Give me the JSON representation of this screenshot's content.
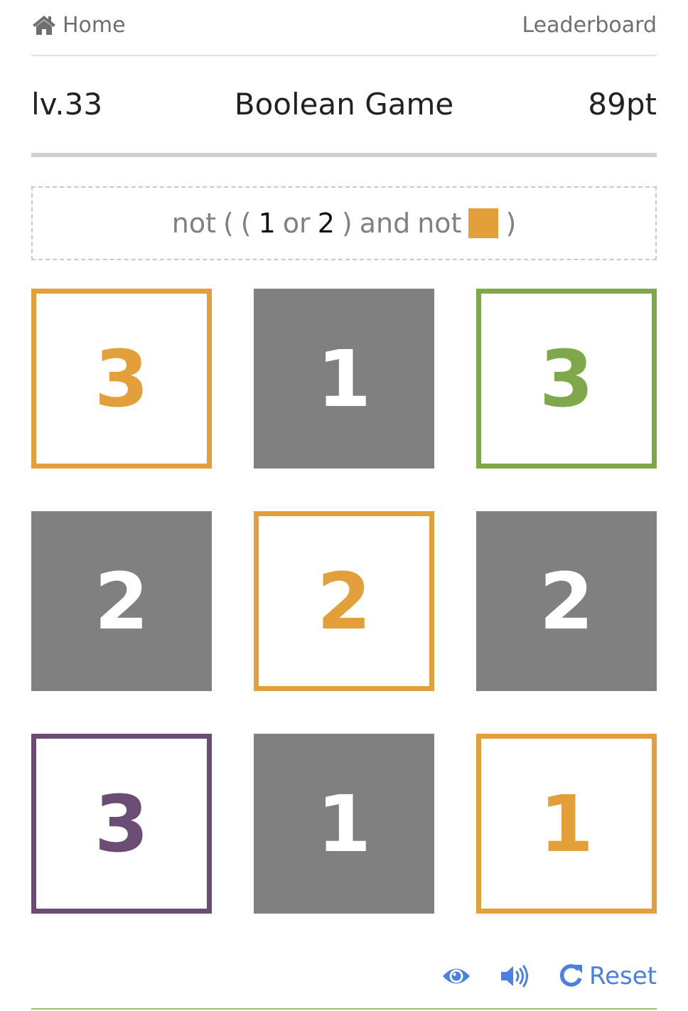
{
  "nav": {
    "home_label": "Home",
    "leaderboard_label": "Leaderboard"
  },
  "header": {
    "level": "lv.33",
    "title": "Boolean Game",
    "points": "89pt"
  },
  "expression": {
    "tokens": [
      {
        "text": "not",
        "kind": "op"
      },
      {
        "text": "(",
        "kind": "op"
      },
      {
        "text": "(",
        "kind": "op"
      },
      {
        "text": "1",
        "kind": "num"
      },
      {
        "text": "or",
        "kind": "op"
      },
      {
        "text": "2",
        "kind": "num"
      },
      {
        "text": ")",
        "kind": "op"
      },
      {
        "text": "and",
        "kind": "op"
      },
      {
        "text": "not",
        "kind": "op"
      },
      {
        "text": "",
        "kind": "swatch",
        "color": "#e3a03a"
      },
      {
        "text": ")",
        "kind": "op"
      }
    ]
  },
  "colors": {
    "orange": "#e3a03a",
    "green": "#7ea84a",
    "purple": "#6b4c74",
    "gray": "#808080",
    "accent": "#4a80e0"
  },
  "tiles": [
    {
      "value": "3",
      "style": "outline",
      "color": "#e3a03a"
    },
    {
      "value": "1",
      "style": "filled",
      "color": "#808080"
    },
    {
      "value": "3",
      "style": "outline",
      "color": "#7ea84a"
    },
    {
      "value": "2",
      "style": "filled",
      "color": "#808080"
    },
    {
      "value": "2",
      "style": "outline",
      "color": "#e3a03a"
    },
    {
      "value": "2",
      "style": "filled",
      "color": "#808080"
    },
    {
      "value": "3",
      "style": "outline",
      "color": "#6b4c74"
    },
    {
      "value": "1",
      "style": "filled",
      "color": "#808080"
    },
    {
      "value": "1",
      "style": "outline",
      "color": "#e3a03a"
    }
  ],
  "footer": {
    "eye_icon": "eye-icon",
    "sound_icon": "volume-icon",
    "reset_icon": "redo-icon",
    "reset_label": "Reset"
  }
}
